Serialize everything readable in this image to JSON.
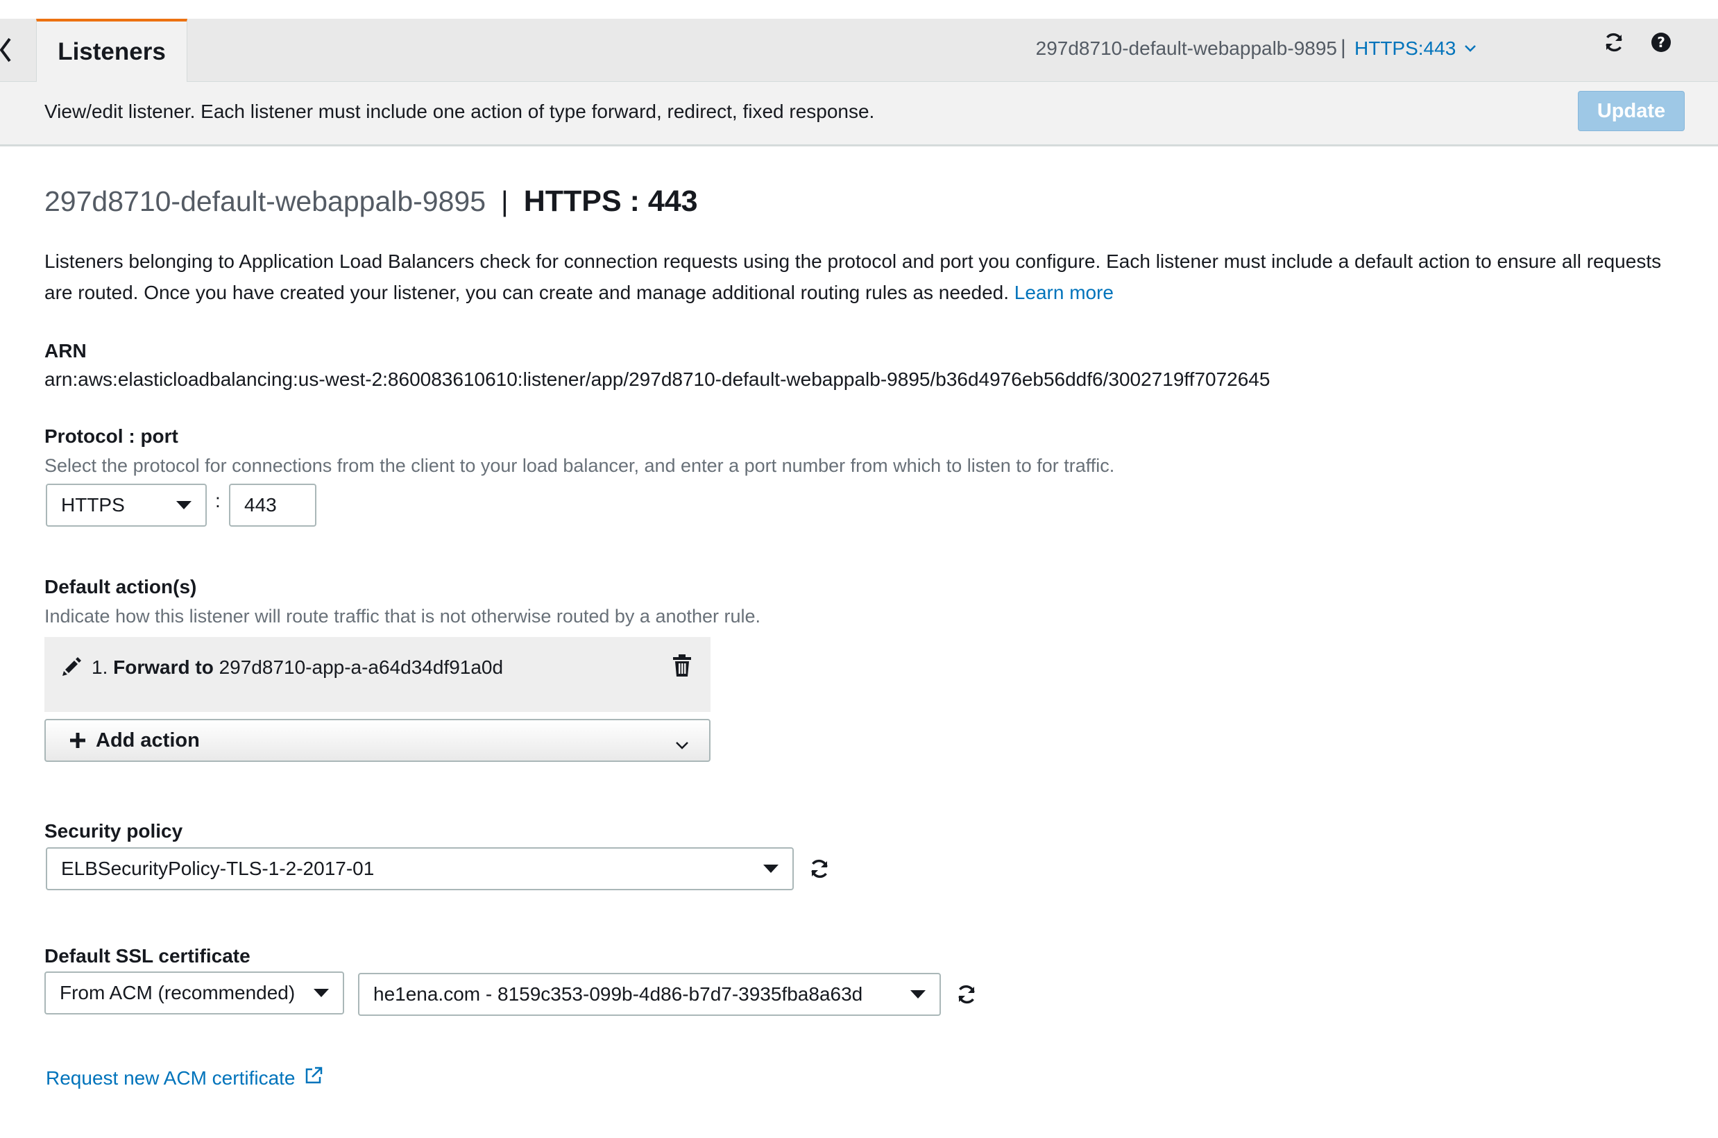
{
  "header": {
    "tab_label": "Listeners",
    "breadcrumb_lb": "297d8710-default-webappalb-9895",
    "breadcrumb_sep": "|",
    "breadcrumb_listener": "HTTPS:443",
    "icons": [
      "back-chevron-icon",
      "chevron-down-icon",
      "refresh-icon",
      "help-icon"
    ]
  },
  "infobar": {
    "text": "View/edit listener. Each listener must include one action of type forward, redirect, fixed response.",
    "update_label": "Update"
  },
  "heading": {
    "lb_name": "297d8710-default-webappalb-9895",
    "sep": "|",
    "protocol": "HTTPS : 443"
  },
  "description": {
    "text": "Listeners belonging to Application Load Balancers check for connection requests using the protocol and port you configure. Each listener must include a default action to ensure all requests are routed. Once you have created your listener, you can create and manage additional routing rules as needed.",
    "learn_more": "Learn more"
  },
  "arn": {
    "label": "ARN",
    "value": "arn:aws:elasticloadbalancing:us-west-2:860083610610:listener/app/297d8710-default-webappalb-9895/b36d4976eb56ddf6/3002719ff7072645"
  },
  "protocol_port": {
    "label": "Protocol : port",
    "help": "Select the protocol for connections from the client to your load balancer, and enter a port number from which to listen to for traffic.",
    "protocol_value": "HTTPS",
    "colon": ":",
    "port_value": "443"
  },
  "default_actions": {
    "label": "Default action(s)",
    "help": "Indicate how this listener will route traffic that is not otherwise routed by a another rule.",
    "actions": [
      {
        "number": "1.",
        "type": "Forward to",
        "target": "297d8710-app-a-a64d34df91a0d"
      }
    ],
    "add_action_label": "Add action"
  },
  "security_policy": {
    "label": "Security policy",
    "value": "ELBSecurityPolicy-TLS-1-2-2017-01"
  },
  "ssl_certificate": {
    "label": "Default SSL certificate",
    "source_value": "From ACM (recommended)",
    "certificate_value": "he1ena.com - 8159c353-099b-4d86-b7d7-3935fba8a63d",
    "request_link": "Request new ACM certificate"
  },
  "colors": {
    "accent_orange": "#ec7211",
    "link_blue": "#0073bb",
    "update_disabled": "#9ec8e6"
  }
}
